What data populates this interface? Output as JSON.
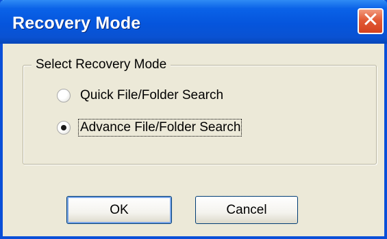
{
  "window": {
    "title": "Recovery Mode",
    "close_glyph": "✕"
  },
  "group": {
    "legend": "Select Recovery Mode",
    "options": [
      {
        "label": "Quick File/Folder Search",
        "selected": false
      },
      {
        "label": "Advance File/Folder Search",
        "selected": true
      }
    ]
  },
  "buttons": {
    "ok_label": "OK",
    "cancel_label": "Cancel"
  },
  "colors": {
    "titlebar": "#0555dc",
    "window_bg": "#ece9d8",
    "close_button": "#d4421f"
  },
  "icons": {
    "close": "close-icon"
  }
}
